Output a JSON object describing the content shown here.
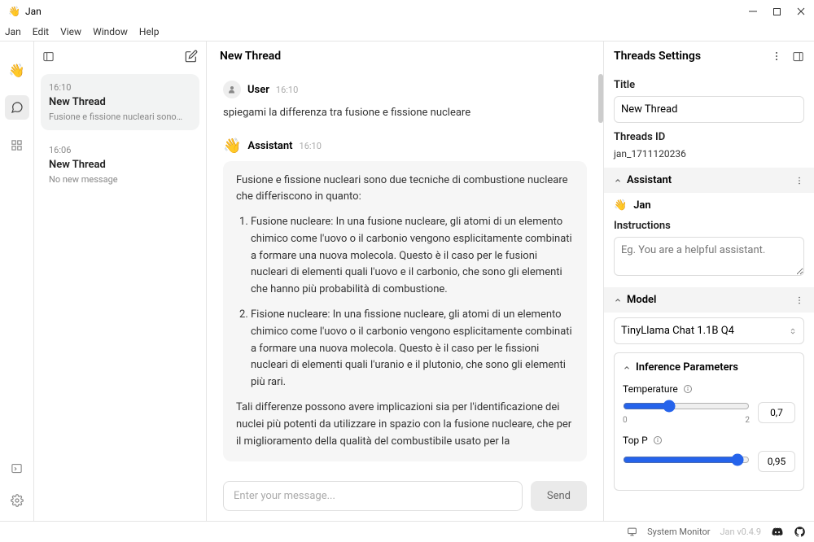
{
  "window": {
    "title": "Jan"
  },
  "menu": [
    "Jan",
    "Edit",
    "View",
    "Window",
    "Help"
  ],
  "threads": [
    {
      "time": "16:10",
      "title": "New Thread",
      "preview": "Fusione e fissione nucleari sono…"
    },
    {
      "time": "16:06",
      "title": "New Thread",
      "preview": "No new message"
    }
  ],
  "chat": {
    "header": "New Thread",
    "input_placeholder": "Enter your message...",
    "send_label": "Send",
    "user_name": "User",
    "user_time": "16:10",
    "user_text": "spiegami la differenza tra fusione e fissione nucleare",
    "assistant_name": "Assistant",
    "assistant_time": "16:10",
    "assistant_intro": "Fusione e fissione nucleari sono due tecniche di combustione nucleare che differiscono in quanto:",
    "assistant_li1": "Fusione nucleare: In una fusione nucleare, gli atomi di un elemento chimico come l'uovo o il carbonio vengono esplicitamente combinati a formare una nuova molecola. Questo è il caso per le fusioni nucleari di elementi quali l'uovo e il carbonio, che sono gli elementi che hanno più probabilità di combustione.",
    "assistant_li2": "Fisione nucleare: In una fissione nucleare, gli atomi di un elemento chimico come l'uovo o il carbonio vengono esplicitamente combinati a formare una nuova molecola. Questo è il caso per le fissioni nucleari di elementi quali l'uranio e il plutonio, che sono gli elementi più rari.",
    "assistant_outro": "Tali differenze possono avere implicazioni sia per l'identificazione dei nuclei più potenti da utilizzare in spazio con la fusione nucleare, che per il miglioramento della qualità del combustibile usato per la"
  },
  "settings": {
    "header": "Threads Settings",
    "title_label": "Title",
    "title_value": "New Thread",
    "id_label": "Threads ID",
    "id_value": "jan_1711120236",
    "assistant_section": "Assistant",
    "assistant_name": "Jan",
    "instructions_label": "Instructions",
    "instructions_placeholder": "Eg. You are a helpful assistant.",
    "model_section": "Model",
    "model_value": "TinyLlama Chat 1.1B Q4",
    "infer_header": "Inference Parameters",
    "temp_label": "Temperature",
    "temp_value": "0,7",
    "temp_min": "0",
    "temp_max": "2",
    "topp_label": "Top P",
    "topp_value": "0,95"
  },
  "status": {
    "sysmon": "System Monitor",
    "version": "Jan v0.4.9"
  }
}
